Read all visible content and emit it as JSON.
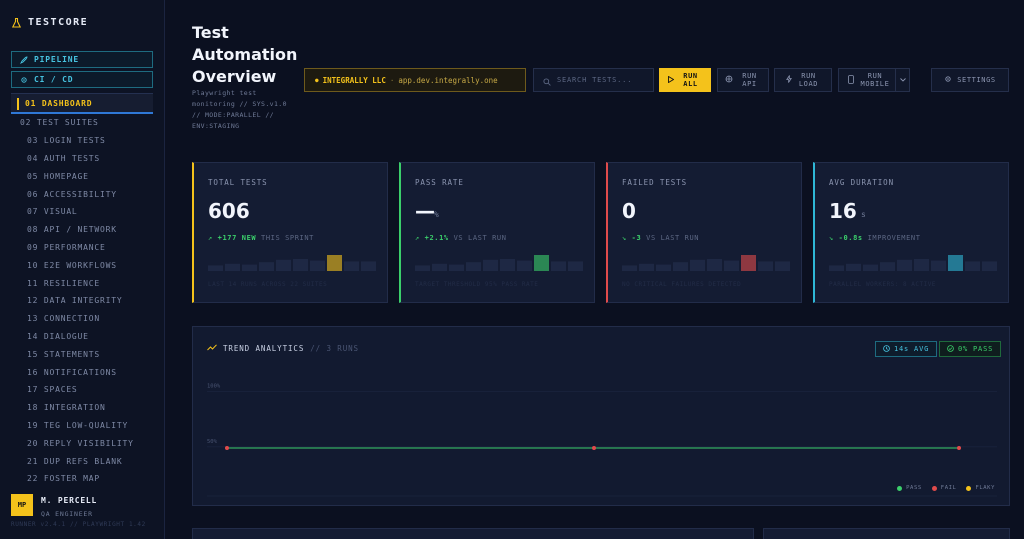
{
  "brand": {
    "name": "TESTCORE",
    "icon": "flask-icon"
  },
  "nav": {
    "pipeline": "PIPELINE",
    "cicd": "CI / CD",
    "items": [
      "01 DASHBOARD",
      "02 TEST SUITES",
      "03 LOGIN TESTS",
      "04 AUTH TESTS",
      "05 HOMEPAGE",
      "06 ACCESSIBILITY",
      "07 VISUAL",
      "08 API / NETWORK",
      "09 PERFORMANCE",
      "10 E2E WORKFLOWS",
      "11 RESILIENCE",
      "12 DATA INTEGRITY",
      "13 CONNECTION",
      "14 DIALOGUE",
      "15 STATEMENTS",
      "16 NOTIFICATIONS",
      "17 SPACES",
      "18 INTEGRATION",
      "19 TEG LOW-QUALITY",
      "20 REPLY VISIBILITY",
      "21 DUP REFS BLANK",
      "22 FOSTER MAP"
    ],
    "active_index": 0
  },
  "user": {
    "initials": "MP",
    "name": "M. PERCELL",
    "role": "QA ENGINEER"
  },
  "sidebar_footer": "RUNNER v2.4.1 // PLAYWRIGHT 1.42",
  "header": {
    "title": "Test Automation Overview",
    "subtitle": "Playwright test monitoring // SYS.v1.0 // MODE:PARALLEL // ENV:STAGING",
    "tenant_org": "INTEGRALLY LLC",
    "tenant_sep": "·",
    "tenant_url": "app.dev.integrally.one",
    "search_placeholder": "SEARCH TESTS...",
    "run_all": "RUN ALL",
    "run_api": "RUN API",
    "run_load": "RUN LOAD",
    "run_mobile": "RUN MOBILE",
    "settings": "SETTINGS"
  },
  "cards": [
    {
      "label": "TOTAL TESTS",
      "value": "606",
      "unit": "",
      "delta": "+177",
      "delta_strong": "NEW",
      "delta_text": "THIS SPRINT",
      "footer": "LAST 14 RUNS ACROSS 22 SUITES",
      "accent": "#f4c21b",
      "highlight": 7
    },
    {
      "label": "PASS RATE",
      "value": "—",
      "unit": "%",
      "delta": "+2.1%",
      "delta_strong": "",
      "delta_text": "VS LAST RUN",
      "footer": "TARGET THRESHOLD 95% PASS RATE",
      "accent": "#3bcf6b",
      "highlight": 7
    },
    {
      "label": "FAILED TESTS",
      "value": "0",
      "unit": "",
      "delta": "-3",
      "delta_strong": "",
      "delta_text": "VS LAST RUN",
      "footer": "NO CRITICAL FAILURES DETECTED",
      "accent": "#e04b4b",
      "highlight": 7
    },
    {
      "label": "AVG DURATION",
      "value": "16",
      "unit": "s",
      "delta": "-0.8s",
      "delta_strong": "",
      "delta_text": "IMPROVEMENT",
      "footer": "PARALLEL WORKERS: 8 ACTIVE",
      "accent": "#2fb7d6",
      "highlight": 7
    }
  ],
  "sparkline_heights": [
    0.35,
    0.45,
    0.4,
    0.55,
    0.7,
    0.75,
    0.65,
    1.0,
    0.6,
    0.6
  ],
  "trend": {
    "title": "TREND ANALYTICS",
    "subtitle": "// 3 RUNS",
    "avg_pill": "14s AVG",
    "pass_pill": "0% PASS",
    "legend": [
      "PASS",
      "FAIL",
      "FLAKY"
    ],
    "colors": {
      "pass": "#3bcf6b",
      "fail": "#e04b4b",
      "flaky": "#f4c21b"
    }
  },
  "chart_data": {
    "type": "line",
    "x": [
      1,
      2,
      3
    ],
    "series": [
      {
        "name": "PASS",
        "values": [
          0,
          0,
          0
        ]
      },
      {
        "name": "FAIL",
        "values": [
          0,
          0,
          0
        ]
      }
    ],
    "yticks": [
      "100%",
      "50%"
    ],
    "ylim": [
      0,
      100
    ]
  }
}
